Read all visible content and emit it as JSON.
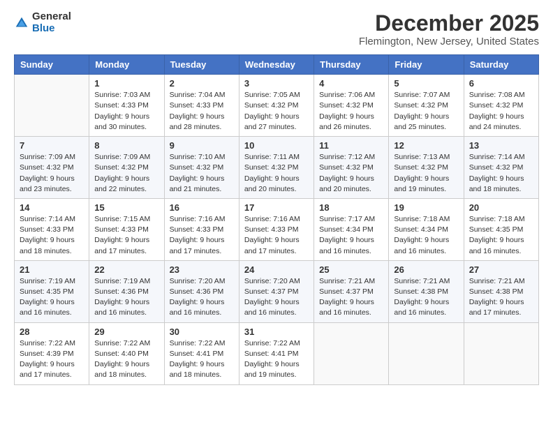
{
  "header": {
    "logo_general": "General",
    "logo_blue": "Blue",
    "title": "December 2025",
    "subtitle": "Flemington, New Jersey, United States"
  },
  "calendar": {
    "weekdays": [
      "Sunday",
      "Monday",
      "Tuesday",
      "Wednesday",
      "Thursday",
      "Friday",
      "Saturday"
    ],
    "weeks": [
      [
        {
          "day": "",
          "sunrise": "",
          "sunset": "",
          "daylight": ""
        },
        {
          "day": "1",
          "sunrise": "Sunrise: 7:03 AM",
          "sunset": "Sunset: 4:33 PM",
          "daylight": "Daylight: 9 hours and 30 minutes."
        },
        {
          "day": "2",
          "sunrise": "Sunrise: 7:04 AM",
          "sunset": "Sunset: 4:33 PM",
          "daylight": "Daylight: 9 hours and 28 minutes."
        },
        {
          "day": "3",
          "sunrise": "Sunrise: 7:05 AM",
          "sunset": "Sunset: 4:32 PM",
          "daylight": "Daylight: 9 hours and 27 minutes."
        },
        {
          "day": "4",
          "sunrise": "Sunrise: 7:06 AM",
          "sunset": "Sunset: 4:32 PM",
          "daylight": "Daylight: 9 hours and 26 minutes."
        },
        {
          "day": "5",
          "sunrise": "Sunrise: 7:07 AM",
          "sunset": "Sunset: 4:32 PM",
          "daylight": "Daylight: 9 hours and 25 minutes."
        },
        {
          "day": "6",
          "sunrise": "Sunrise: 7:08 AM",
          "sunset": "Sunset: 4:32 PM",
          "daylight": "Daylight: 9 hours and 24 minutes."
        }
      ],
      [
        {
          "day": "7",
          "sunrise": "Sunrise: 7:09 AM",
          "sunset": "Sunset: 4:32 PM",
          "daylight": "Daylight: 9 hours and 23 minutes."
        },
        {
          "day": "8",
          "sunrise": "Sunrise: 7:09 AM",
          "sunset": "Sunset: 4:32 PM",
          "daylight": "Daylight: 9 hours and 22 minutes."
        },
        {
          "day": "9",
          "sunrise": "Sunrise: 7:10 AM",
          "sunset": "Sunset: 4:32 PM",
          "daylight": "Daylight: 9 hours and 21 minutes."
        },
        {
          "day": "10",
          "sunrise": "Sunrise: 7:11 AM",
          "sunset": "Sunset: 4:32 PM",
          "daylight": "Daylight: 9 hours and 20 minutes."
        },
        {
          "day": "11",
          "sunrise": "Sunrise: 7:12 AM",
          "sunset": "Sunset: 4:32 PM",
          "daylight": "Daylight: 9 hours and 20 minutes."
        },
        {
          "day": "12",
          "sunrise": "Sunrise: 7:13 AM",
          "sunset": "Sunset: 4:32 PM",
          "daylight": "Daylight: 9 hours and 19 minutes."
        },
        {
          "day": "13",
          "sunrise": "Sunrise: 7:14 AM",
          "sunset": "Sunset: 4:32 PM",
          "daylight": "Daylight: 9 hours and 18 minutes."
        }
      ],
      [
        {
          "day": "14",
          "sunrise": "Sunrise: 7:14 AM",
          "sunset": "Sunset: 4:33 PM",
          "daylight": "Daylight: 9 hours and 18 minutes."
        },
        {
          "day": "15",
          "sunrise": "Sunrise: 7:15 AM",
          "sunset": "Sunset: 4:33 PM",
          "daylight": "Daylight: 9 hours and 17 minutes."
        },
        {
          "day": "16",
          "sunrise": "Sunrise: 7:16 AM",
          "sunset": "Sunset: 4:33 PM",
          "daylight": "Daylight: 9 hours and 17 minutes."
        },
        {
          "day": "17",
          "sunrise": "Sunrise: 7:16 AM",
          "sunset": "Sunset: 4:33 PM",
          "daylight": "Daylight: 9 hours and 17 minutes."
        },
        {
          "day": "18",
          "sunrise": "Sunrise: 7:17 AM",
          "sunset": "Sunset: 4:34 PM",
          "daylight": "Daylight: 9 hours and 16 minutes."
        },
        {
          "day": "19",
          "sunrise": "Sunrise: 7:18 AM",
          "sunset": "Sunset: 4:34 PM",
          "daylight": "Daylight: 9 hours and 16 minutes."
        },
        {
          "day": "20",
          "sunrise": "Sunrise: 7:18 AM",
          "sunset": "Sunset: 4:35 PM",
          "daylight": "Daylight: 9 hours and 16 minutes."
        }
      ],
      [
        {
          "day": "21",
          "sunrise": "Sunrise: 7:19 AM",
          "sunset": "Sunset: 4:35 PM",
          "daylight": "Daylight: 9 hours and 16 minutes."
        },
        {
          "day": "22",
          "sunrise": "Sunrise: 7:19 AM",
          "sunset": "Sunset: 4:36 PM",
          "daylight": "Daylight: 9 hours and 16 minutes."
        },
        {
          "day": "23",
          "sunrise": "Sunrise: 7:20 AM",
          "sunset": "Sunset: 4:36 PM",
          "daylight": "Daylight: 9 hours and 16 minutes."
        },
        {
          "day": "24",
          "sunrise": "Sunrise: 7:20 AM",
          "sunset": "Sunset: 4:37 PM",
          "daylight": "Daylight: 9 hours and 16 minutes."
        },
        {
          "day": "25",
          "sunrise": "Sunrise: 7:21 AM",
          "sunset": "Sunset: 4:37 PM",
          "daylight": "Daylight: 9 hours and 16 minutes."
        },
        {
          "day": "26",
          "sunrise": "Sunrise: 7:21 AM",
          "sunset": "Sunset: 4:38 PM",
          "daylight": "Daylight: 9 hours and 16 minutes."
        },
        {
          "day": "27",
          "sunrise": "Sunrise: 7:21 AM",
          "sunset": "Sunset: 4:38 PM",
          "daylight": "Daylight: 9 hours and 17 minutes."
        }
      ],
      [
        {
          "day": "28",
          "sunrise": "Sunrise: 7:22 AM",
          "sunset": "Sunset: 4:39 PM",
          "daylight": "Daylight: 9 hours and 17 minutes."
        },
        {
          "day": "29",
          "sunrise": "Sunrise: 7:22 AM",
          "sunset": "Sunset: 4:40 PM",
          "daylight": "Daylight: 9 hours and 18 minutes."
        },
        {
          "day": "30",
          "sunrise": "Sunrise: 7:22 AM",
          "sunset": "Sunset: 4:41 PM",
          "daylight": "Daylight: 9 hours and 18 minutes."
        },
        {
          "day": "31",
          "sunrise": "Sunrise: 7:22 AM",
          "sunset": "Sunset: 4:41 PM",
          "daylight": "Daylight: 9 hours and 19 minutes."
        },
        {
          "day": "",
          "sunrise": "",
          "sunset": "",
          "daylight": ""
        },
        {
          "day": "",
          "sunrise": "",
          "sunset": "",
          "daylight": ""
        },
        {
          "day": "",
          "sunrise": "",
          "sunset": "",
          "daylight": ""
        }
      ]
    ]
  }
}
